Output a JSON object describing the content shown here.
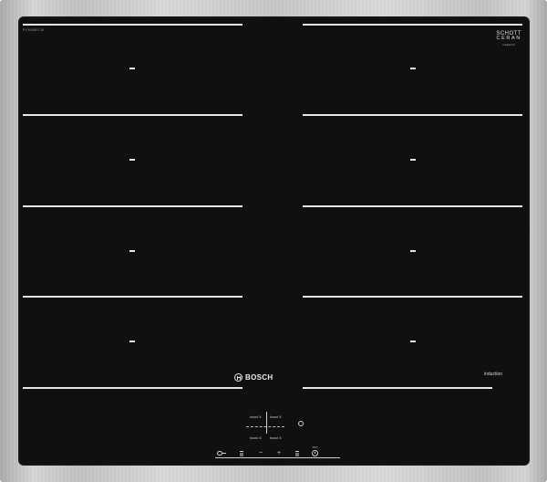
{
  "appliance": {
    "model_label": "PXX645FC1E",
    "glass_brand": {
      "line1": "SCHOTT",
      "line2": "CERAN",
      "line3": "CERAN®"
    },
    "brand": "BOSCH",
    "type_label": "induction"
  },
  "cooking_zones": {
    "left_column": [
      "zone-1",
      "zone-2",
      "zone-3",
      "zone-4"
    ],
    "right_column": [
      "zone-1",
      "zone-2",
      "zone-3",
      "zone-4"
    ]
  },
  "zone_labels": {
    "top_left": "boost ①",
    "top_right": "boost ①",
    "bottom_left": "boost ①",
    "bottom_right": "boost ①",
    "small": "4/8/9"
  },
  "controls": [
    {
      "name": "childlock",
      "icon": "key-icon"
    },
    {
      "name": "menu-left",
      "icon": "menu-icon"
    },
    {
      "name": "minus",
      "symbol": "−"
    },
    {
      "name": "plus",
      "symbol": "+"
    },
    {
      "name": "menu-right",
      "icon": "menu-icon"
    },
    {
      "name": "timer",
      "icon": "timer-icon"
    }
  ],
  "colors": {
    "glass": "#101010",
    "frame": "#c8cacc",
    "markings": "#e6e6e6"
  }
}
